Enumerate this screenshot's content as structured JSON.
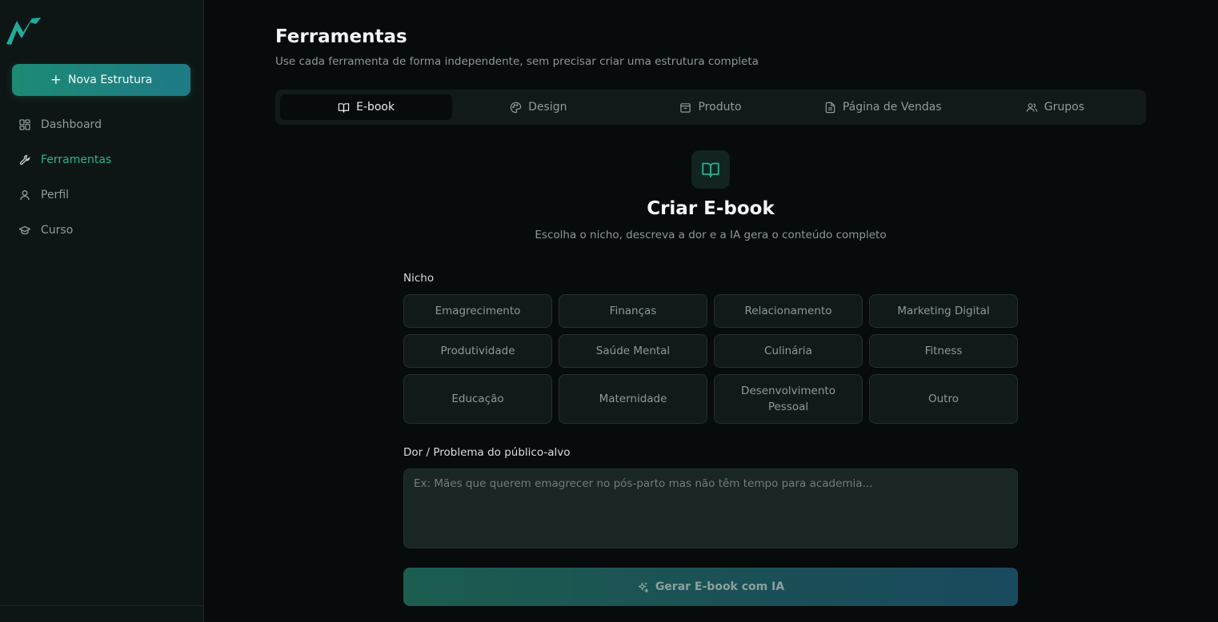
{
  "sidebar": {
    "new_button_label": "Nova Estrutura",
    "items": [
      {
        "label": "Dashboard",
        "icon": "dashboard-icon"
      },
      {
        "label": "Ferramentas",
        "icon": "wrench-icon",
        "active": true
      },
      {
        "label": "Perfil",
        "icon": "user-icon"
      },
      {
        "label": "Curso",
        "icon": "graduation-cap-icon"
      }
    ]
  },
  "header": {
    "title": "Ferramentas",
    "subtitle": "Use cada ferramenta de forma independente, sem precisar criar uma estrutura completa"
  },
  "tabs": [
    {
      "label": "E-book",
      "icon": "book-open-icon",
      "active": true
    },
    {
      "label": "Design",
      "icon": "palette-icon"
    },
    {
      "label": "Produto",
      "icon": "package-icon"
    },
    {
      "label": "Página de Vendas",
      "icon": "file-text-icon"
    },
    {
      "label": "Grupos",
      "icon": "users-icon"
    }
  ],
  "ebook": {
    "title": "Criar E-book",
    "subtitle": "Escolha o nicho, descreva a dor e a IA gera o conteúdo completo",
    "niche_label": "Nicho",
    "niches": [
      "Emagrecimento",
      "Finanças",
      "Relacionamento",
      "Marketing Digital",
      "Produtividade",
      "Saúde Mental",
      "Culinária",
      "Fitness",
      "Educação",
      "Maternidade",
      "Desenvolvimento Pessoal",
      "Outro"
    ],
    "pain_label": "Dor / Problema do público-alvo",
    "pain_placeholder": "Ex: Mães que querem emagrecer no pós-parto mas não têm tempo para academia...",
    "pain_value": "",
    "generate_label": "Gerar E-book com IA"
  },
  "colors": {
    "accent": "#2fb08f",
    "background": "#070b0b",
    "sidebar": "#0e1615"
  }
}
